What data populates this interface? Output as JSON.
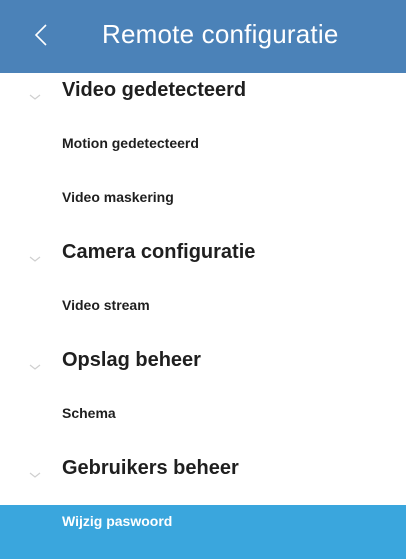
{
  "header": {
    "title": "Remote configuratie",
    "back_icon": "chevron-left-icon",
    "background_color": "#4b82b8"
  },
  "sections": [
    {
      "label": "Video gedetecteerd",
      "expanded": true,
      "items": [
        {
          "label": "Motion gedetecteerd"
        },
        {
          "label": "Video maskering"
        }
      ]
    },
    {
      "label": "Camera configuratie",
      "expanded": true,
      "items": [
        {
          "label": "Video stream"
        }
      ]
    },
    {
      "label": "Opslag beheer",
      "expanded": true,
      "items": [
        {
          "label": "Schema"
        }
      ]
    },
    {
      "label": "Gebruikers beheer",
      "expanded": true,
      "items": [
        {
          "label": "Wijzig paswoord",
          "selected": true
        }
      ]
    }
  ],
  "colors": {
    "selected_row": "#3aa6dd",
    "text": "#1f1f1f"
  }
}
